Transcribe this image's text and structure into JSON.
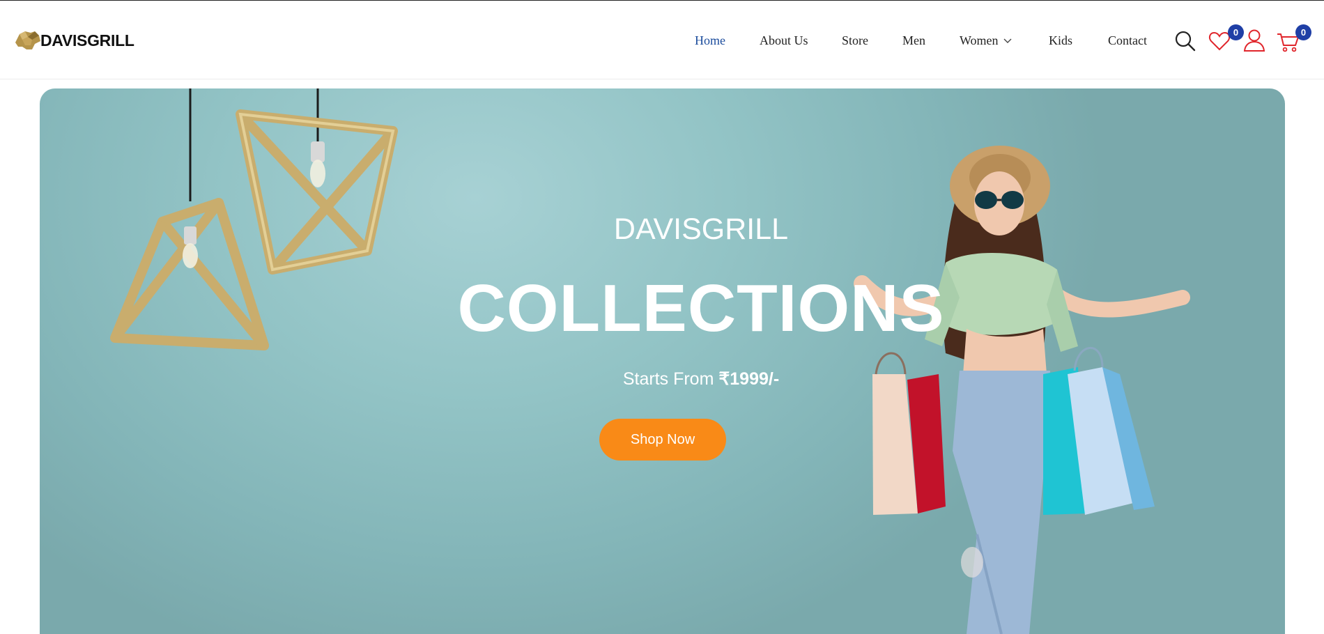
{
  "logo": {
    "bold": "DAVIS",
    "light": "GRILL"
  },
  "nav": {
    "items": [
      {
        "label": "Home",
        "active": true
      },
      {
        "label": "About Us"
      },
      {
        "label": "Store"
      },
      {
        "label": "Men"
      },
      {
        "label": "Women",
        "has_dropdown": true
      },
      {
        "label": "Kids"
      },
      {
        "label": "Contact"
      }
    ]
  },
  "header_icons": {
    "search": "search-icon",
    "wishlist": {
      "icon": "heart-icon",
      "count": "0"
    },
    "account": "user-icon",
    "cart": {
      "icon": "cart-icon",
      "count": "0"
    }
  },
  "hero": {
    "brand": "DAVISGRILL",
    "title": "COLLECTIONS",
    "price_prefix": "Starts From",
    "price_value": "₹1999/-",
    "cta_label": "Shop Now"
  },
  "colors": {
    "active_nav": "#1a4b9c",
    "badge": "#1f3fa6",
    "cta": "#f98a17",
    "hero_bg": "#93c4c6",
    "icon_red": "#e0252b"
  }
}
